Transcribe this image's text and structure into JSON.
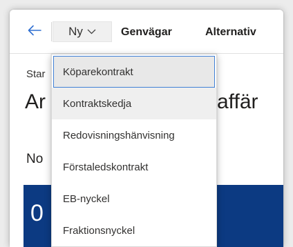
{
  "toolbar": {
    "back_icon": "arrow-left-icon",
    "new_label": "Ny",
    "new_chevron_icon": "chevron-down-icon",
    "shortcuts_label": "Genvägar",
    "options_label": "Alternativ"
  },
  "page": {
    "breadcrumb_fragment": "Star",
    "title_fragment_left": "Ar",
    "title_fragment_right": "affär",
    "section_fragment": "No",
    "tile_value_fragment": "0"
  },
  "menu": {
    "items": [
      {
        "label": "Köparekontrakt"
      },
      {
        "label": "Kontraktskedja"
      },
      {
        "label": "Redovisningshänvisning"
      },
      {
        "label": "Förstaledskontrakt"
      },
      {
        "label": "EB-nyckel"
      },
      {
        "label": "Fraktionsnyckel"
      }
    ]
  },
  "colors": {
    "accent": "#0078d4",
    "tile_background": "#0c3a82",
    "focus_border": "#3f7fd6"
  }
}
